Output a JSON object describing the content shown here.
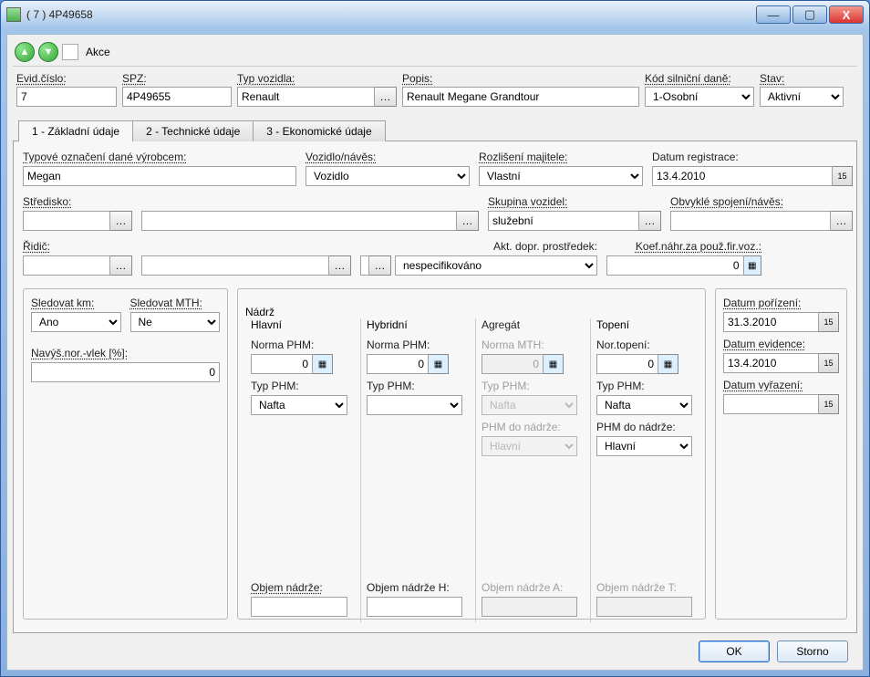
{
  "window": {
    "title": "( 7 )  4P49658"
  },
  "toolbar": {
    "akce": "Akce"
  },
  "header": {
    "evid_label": "Evid.číslo:",
    "evid": "7",
    "spz_label": "SPZ:",
    "spz": "4P49655",
    "typ_label": "Typ vozidla:",
    "typ": "Renault",
    "popis_label": "Popis:",
    "popis": "Renault Megane Grandtour",
    "dan_label": "Kód silniční daně:",
    "dan": "1-Osobní",
    "stav_label": "Stav:",
    "stav": "Aktivní"
  },
  "tabs": {
    "t1": "1 - Základní údaje",
    "t2": "2 - Technické údaje",
    "t3": "3 - Ekonomické údaje"
  },
  "basic": {
    "typove_label": "Typové označení dané výrobcem:",
    "typove": "Megan",
    "voz_label": "Vozidlo/návěs:",
    "voz": "Vozidlo",
    "rozl_label": "Rozlišení majitele:",
    "rozl": "Vlastní",
    "datreg_label": "Datum registrace:",
    "datreg": "13.4.2010",
    "stredisko_label": "Středisko:",
    "skupina_label": "Skupina vozidel:",
    "skupina": "služební",
    "obvykle_label": "Obvyklé spojení/návěs:",
    "ridic_label": "Řidič:",
    "aktdopr_label": "Akt. dopr. prostředek:",
    "aktdopr": "nespecifikováno",
    "koef_label": "Koef.náhr.za použ.fir.voz.:",
    "koef": "0"
  },
  "tracking": {
    "km_label": "Sledovat km:",
    "km": "Ano",
    "mth_label": "Sledovat MTH:",
    "mth": "Ne",
    "navys_label": "Navýš.nor.-vlek [%]:",
    "navys": "0"
  },
  "nadrz": {
    "legend": "Nádrž",
    "hlavni": {
      "title": "Hlavní",
      "norma_label": "Norma PHM:",
      "norma": "0",
      "typ_label": "Typ PHM:",
      "typ": "Nafta",
      "objem_label": "Objem nádrže:"
    },
    "hybrid": {
      "title": "Hybridní",
      "norma_label": "Norma PHM:",
      "norma": "0",
      "typ_label": "Typ PHM:",
      "typ": "",
      "objem_label": "Objem nádrže H:"
    },
    "agregat": {
      "title": "Agregát",
      "norma_label": "Norma MTH:",
      "norma": "0",
      "typ_label": "Typ PHM:",
      "typ": "Nafta",
      "phmdo_label": "PHM do nádrže:",
      "phmdo": "Hlavní",
      "objem_label": "Objem nádrže A:"
    },
    "topeni": {
      "title": "Topení",
      "norma_label": "Nor.topení:",
      "norma": "0",
      "typ_label": "Typ PHM:",
      "typ": "Nafta",
      "phmdo_label": "PHM do nádrže:",
      "phmdo": "Hlavní",
      "objem_label": "Objem nádrže T:"
    }
  },
  "dates": {
    "por_label": "Datum pořízení:",
    "por": "31.3.2010",
    "evi_label": "Datum evidence:",
    "evi": "13.4.2010",
    "vyr_label": "Datum vyřazení:",
    "vyr": ""
  },
  "buttons": {
    "ok": "OK",
    "storno": "Storno"
  }
}
